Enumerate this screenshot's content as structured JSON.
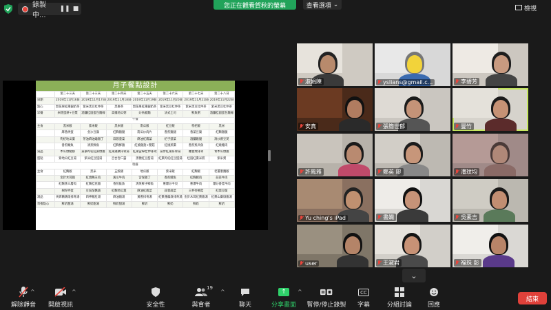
{
  "topbar": {
    "recording_label": "錄製中...",
    "pause_symbol": "❚❚",
    "stop_symbol": "■",
    "share_banner": "您正在觀看賀秋的螢幕",
    "view_options": "查看選項",
    "view_options_caret": "⌄",
    "gallery_label": "檢視"
  },
  "shared_doc": {
    "title": "月子餐點設計",
    "rows": [
      [
        "",
        "第二十三天",
        "第二十三天",
        "第二十四天",
        "第二十五天",
        "第二十六天",
        "第二十七天",
        "第二十八日"
      ],
      [
        "日期",
        "2019年11月16日(六)",
        "2019年11月17日(日)",
        "2019年11月18日(一)",
        "2019年11月19日(二)",
        "2019年11月20日(三)",
        "2019年11月21日(四)",
        "2019年11月22日(五)"
      ],
      [
        "點心",
        "無花果紅棗銀奶茶",
        "紫米黑豆杜仲茶",
        "黑麥茶",
        "無花果紅棗銀奶茶",
        "紫米黑豆杜仲茶",
        "紫米黑豆杜仲茶",
        "紫米黑豆杜仲茶"
      ],
      [
        "早餐",
        "米糕蛋餅+豆漿",
        "酒釀桂圓蛋包麵線",
        "高纖地瓜粥",
        "炒烏龍麵",
        "法式土司",
        "鮮魚粥",
        "酒釀桂圓蛋包麵線"
      ],
      [
        "午餐"
      ],
      [
        "主食",
        "黑米飯",
        "紫米飯",
        "黑米飯",
        "南瓜飯",
        "紅豆飯",
        "枸杞飯",
        "黑米"
      ],
      [
        "",
        "麻香烘蛋",
        "金沙豆腐",
        "紅麴雞腿",
        "南瓜炒肉片",
        "香煎雞腿",
        "香菜豆腐",
        "紅麴雞腿"
      ],
      [
        "",
        "枸杞地瓜葉",
        "茶油麻油燴雞丁",
        "蒜蓉菠菜",
        "麻油紅鳳菜",
        "杞子菠菜",
        "酒釀雞腿",
        "清炒豌豆莢"
      ],
      [
        "",
        "香煎鯖魚",
        "清蒸鮮魚",
        "紅麴鮮雞",
        "紅燒雞翅+雙菇",
        "紅燒蒸羹",
        "香煎虱目魚",
        "紅燒豬肉"
      ],
      [
        "湯品",
        "木瓜燉豬腳",
        "黨蔘枸杞紅棗燉雞",
        "紅棗蓮藕排骨湯",
        "紅棗當歸杜仲排骨湯",
        "黨參紅棗排骨湯",
        "蘿蔔燉排骨",
        "青木瓜燉雞"
      ],
      [
        "甜點",
        "紫地瓜紅豆湯",
        "紫米紅豆甜湯",
        "百合杏仁露",
        "黑糖紅豆甜湯",
        "紅棗枸杞紅豆甜湯",
        "桂圓紅棗米糕",
        "紫米粥"
      ],
      [
        "晚餐"
      ],
      [
        "主食",
        "紅麴飯",
        "黑米",
        "五穀飯",
        "地瓜飯",
        "紫米飯",
        "紅麴飯",
        "老薑蔥麵飯"
      ],
      [
        "",
        "金針木耳雞",
        "紅燒鴨羊肉",
        "黃瓜牛肉",
        "宮保雞丁",
        "香煎鱈魚",
        "紅麴豬肉",
        "蒜苗牛肉"
      ],
      [
        "",
        "紅麴蒸三層肉",
        "紅麴桂花雞",
        "香煎鮭魚",
        "清蒸鮮子鯽魚",
        "蔥爆炒干貝",
        "蔥爆牛肉",
        "爆炒香菇牛肉"
      ],
      [
        "",
        "樹籽拌蛋",
        "豆豉茄醬蔬",
        "紅麴地瓜葉",
        "麻油紅鳳菜",
        "蒜蓉蔬菜",
        "三杯杏鮑菇",
        "紅燒豆腐"
      ],
      [
        "湯品",
        "天麻鵪鶉燉排骨湯",
        "四神豬肚湯",
        "麻油雞湯",
        "黃耆排骨湯",
        "紅棗蓮藕燉排骨湯",
        "金針木耳紅棗雞湯",
        "紅棗山藥燉雞湯"
      ],
      [
        "宵夜點心",
        "鮮奶甜湯",
        "鮮奶甜湯",
        "鮮奶甜湯",
        "鮮奶",
        "鮮奶",
        "鮮奶",
        "鮮奶"
      ]
    ]
  },
  "participants": [
    {
      "name": "淑娟陳"
    },
    {
      "name": "yslians@gmail.c..."
    },
    {
      "name": "李碧芳"
    },
    {
      "name": "安真"
    },
    {
      "name": "張簡世郁"
    },
    {
      "name": "曼竹"
    },
    {
      "name": "許鳳雅"
    },
    {
      "name": "鄭英 廖"
    },
    {
      "name": "潘玟均"
    },
    {
      "name": "Yu ching's iPad"
    },
    {
      "name": "書嫻"
    },
    {
      "name": "吳素吉"
    },
    {
      "name": "user"
    },
    {
      "name": "王淑君"
    },
    {
      "name": "福珠 彭"
    }
  ],
  "gallery_next": "⌄",
  "toolbar": {
    "unmute": "解除靜音",
    "start_video": "開啟視訊",
    "security": "安全性",
    "participants": "與會者",
    "participant_count": "19",
    "chat": "聊天",
    "share_screen": "分享畫面",
    "pause_recording": "暫停/停止錄製",
    "captions": "字幕",
    "captions_icon": "CC",
    "breakout": "分組討論",
    "reactions": "回應",
    "end": "結束",
    "caret": "^"
  },
  "colors": {
    "share_green": "#21a35a",
    "end_red": "#e0413a",
    "active_speaker": "#c7e860",
    "doc_header": "#8bb058"
  }
}
